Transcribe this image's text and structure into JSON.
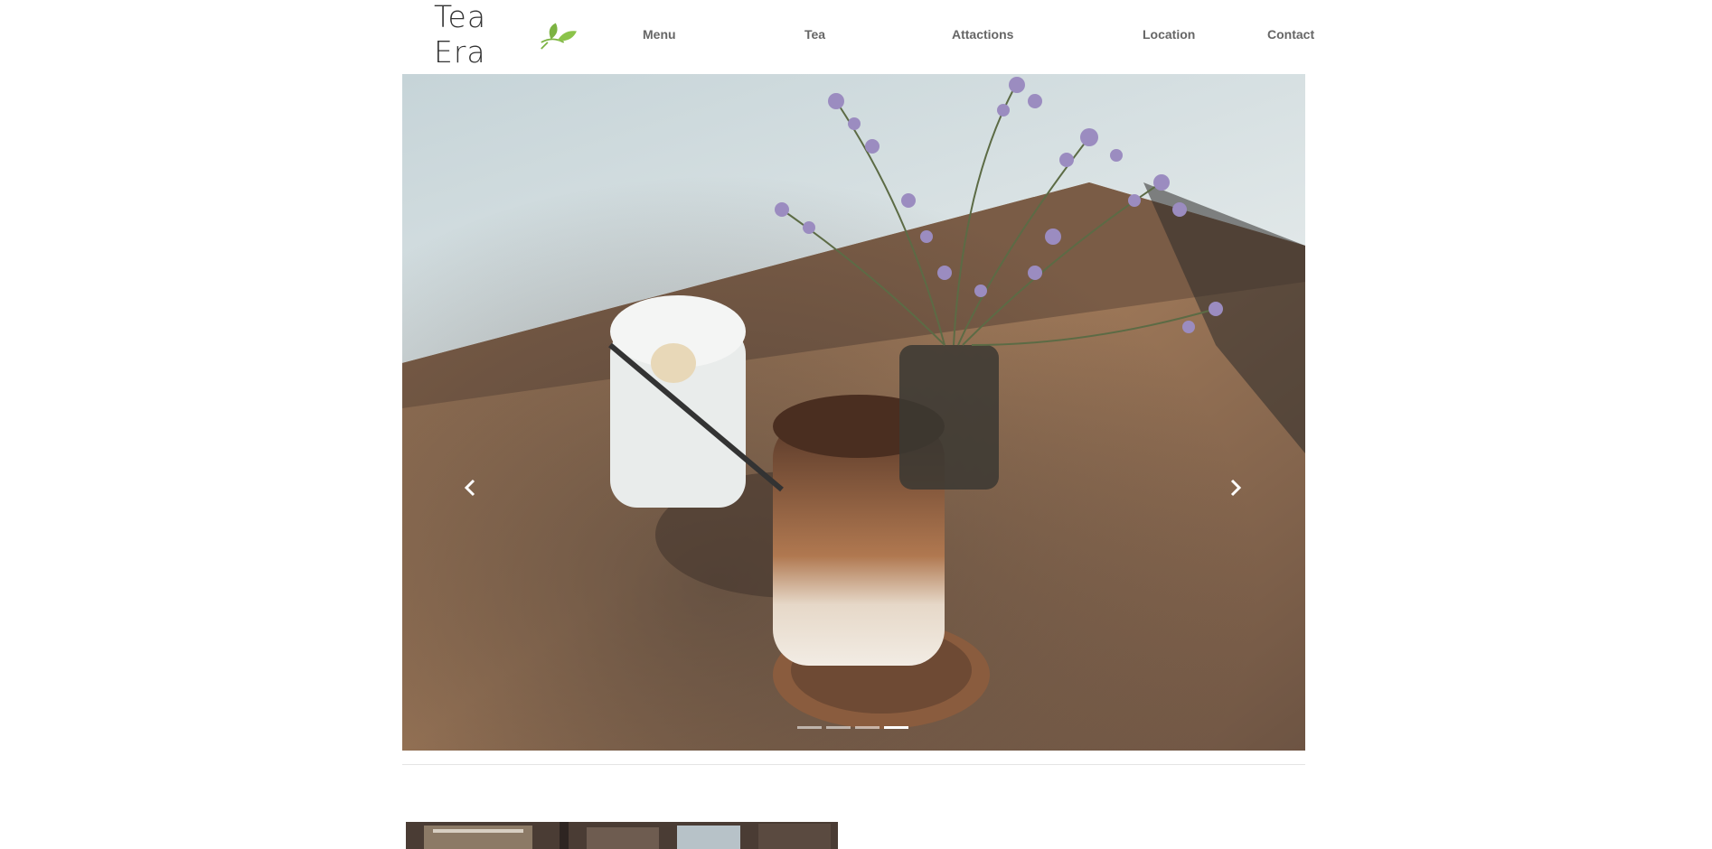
{
  "brand": {
    "logo_text": "Tea Era",
    "leaf_color": "#7cb342"
  },
  "nav": {
    "items": [
      {
        "label": "Menu"
      },
      {
        "label": "Tea"
      },
      {
        "label": "Attactions"
      },
      {
        "label": "Location"
      },
      {
        "label": "Contact"
      }
    ]
  },
  "carousel": {
    "slide_count": 4,
    "active_slide": 4,
    "prev_icon": "chevron-left-icon",
    "next_icon": "chevron-right-icon",
    "image": "iced coffee and milk drink on wooden table with lavender flowers"
  },
  "colors": {
    "nav_text": "#666666",
    "divider": "#e4e4e4"
  }
}
